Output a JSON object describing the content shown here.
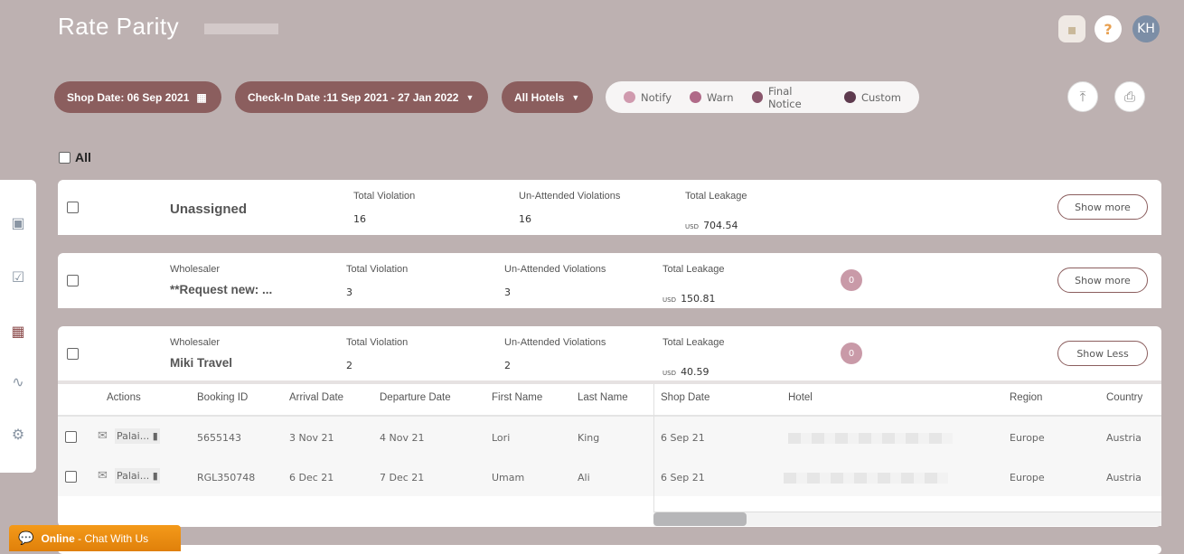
{
  "header": {
    "title": "Rate Parity",
    "avatar": "KH",
    "help": "?",
    "icons": [
      "feedback-icon",
      "help-icon"
    ]
  },
  "filters": {
    "shop_date": "Shop Date: 06 Sep 2021",
    "checkin": "Check-In Date :11 Sep 2021 - 27 Jan 2022",
    "hotels": "All Hotels"
  },
  "legend": [
    {
      "label": "Notify",
      "color": "#d09aae"
    },
    {
      "label": "Warn",
      "color": "#b06a88"
    },
    {
      "label": "Final Notice",
      "color": "#8a566c"
    },
    {
      "label": "Custom",
      "color": "#5e3a4e"
    }
  ],
  "select_all": "All",
  "labels": {
    "total_violation": "Total Violation",
    "unattended": "Un-Attended Violations",
    "leakage": "Total Leakage",
    "currency": "USD",
    "wholesaler": "Wholesaler",
    "show_more": "Show more",
    "show_less": "Show Less"
  },
  "cards": [
    {
      "name": "Unassigned",
      "total": "16",
      "unattended": "16",
      "leakage": "704.54"
    },
    {
      "name": "**Request new: ...",
      "total": "3",
      "unattended": "3",
      "leakage": "150.81",
      "badge": "0"
    },
    {
      "name": "Miki Travel",
      "total": "2",
      "unattended": "2",
      "leakage": "40.59",
      "badge": "0"
    }
  ],
  "table": {
    "headers": [
      "Actions",
      "Booking ID",
      "Arrival Date",
      "Departure Date",
      "First Name",
      "Last Name",
      "Shop Date",
      "Hotel",
      "Region",
      "Country"
    ],
    "rows": [
      {
        "action": "Palai...",
        "booking": "5655143",
        "arrival": "3 Nov 21",
        "departure": "4 Nov 21",
        "first": "Lori",
        "last": "King",
        "shop": "6 Sep 21",
        "region": "Europe",
        "country": "Austria"
      },
      {
        "action": "Palai...",
        "booking": "RGL350748",
        "arrival": "6 Dec 21",
        "departure": "7 Dec 21",
        "first": "Umam",
        "last": "Ali",
        "shop": "6 Sep 21",
        "region": "Europe",
        "country": "Austria"
      }
    ]
  },
  "chat": {
    "status": "Online",
    "label": " - Chat With Us"
  }
}
